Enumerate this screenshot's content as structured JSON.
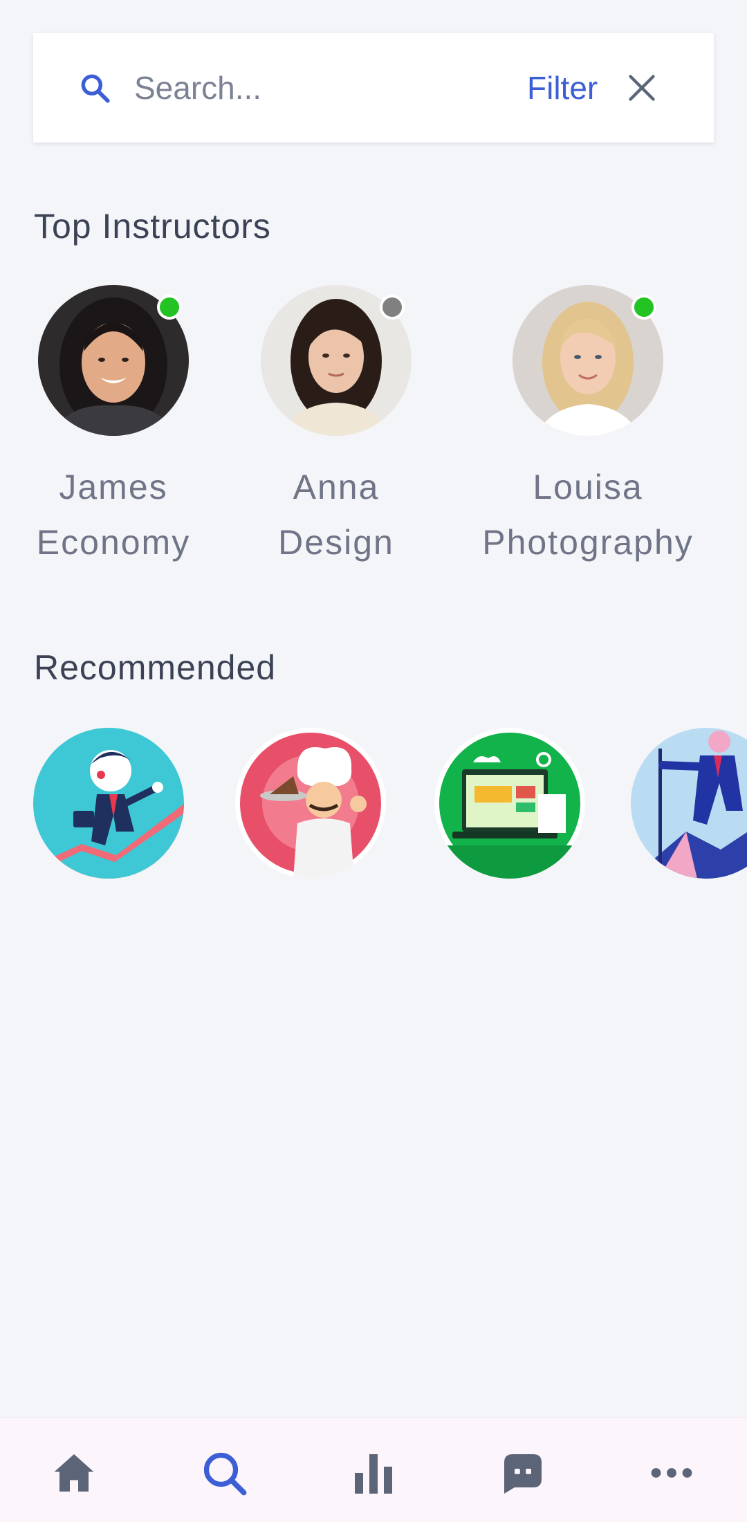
{
  "search": {
    "placeholder": "Search...",
    "filter_label": "Filter"
  },
  "sections": {
    "top_instructors_title": "Top Instructors",
    "recommended_title": "Recommended"
  },
  "instructors": [
    {
      "name": "James",
      "subject": "Economy",
      "status": "online",
      "status_color": "#22c322"
    },
    {
      "name": "Anna",
      "subject": "Design",
      "status": "offline",
      "status_color": "#808080"
    },
    {
      "name": "Louisa",
      "subject": "Photography",
      "status": "online",
      "status_color": "#22c322"
    }
  ],
  "recommended": [
    {
      "icon": "businessman-running-illustration"
    },
    {
      "icon": "chef-with-cake-illustration"
    },
    {
      "icon": "web-design-laptop-illustration"
    },
    {
      "icon": "businessman-climbing-mountain-illustration"
    }
  ],
  "bottom_nav": [
    {
      "icon": "home-icon",
      "active": false
    },
    {
      "icon": "search-icon",
      "active": true
    },
    {
      "icon": "bar-chart-icon",
      "active": false
    },
    {
      "icon": "chat-icon",
      "active": false
    },
    {
      "icon": "more-icon",
      "active": false
    }
  ],
  "colors": {
    "accent": "#3d5fd6",
    "background": "#f4f5f9",
    "nav_inactive": "#5c6577",
    "online": "#22c322",
    "offline": "#808080"
  }
}
